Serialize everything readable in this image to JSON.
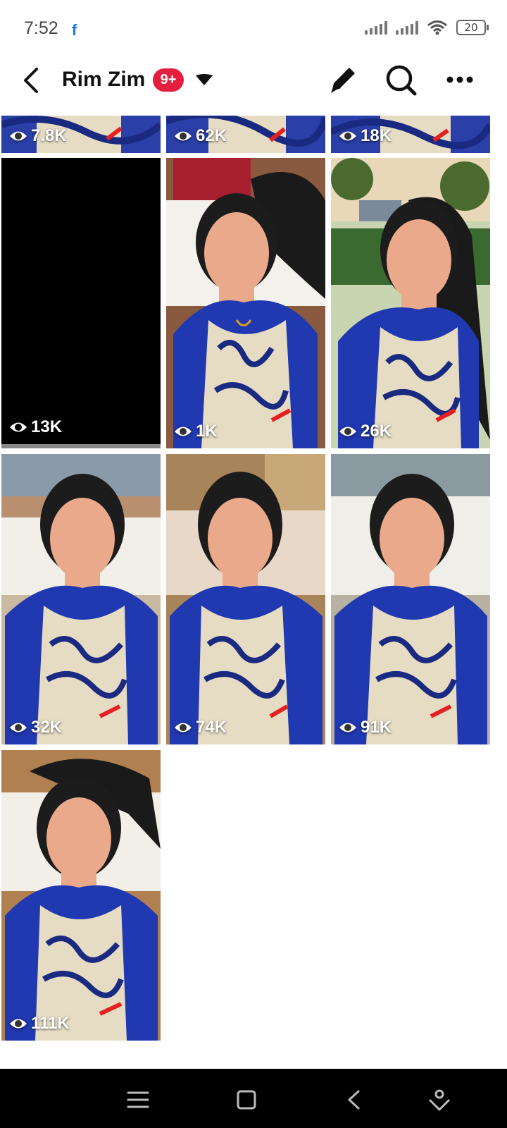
{
  "status_bar": {
    "time": "7:52",
    "notification_icon": "facebook-icon",
    "battery": "20"
  },
  "header": {
    "title": "Rim Zim",
    "badge": "9+",
    "icons": [
      "back-arrow-icon",
      "caret-down-icon",
      "pencil-icon",
      "search-icon",
      "more-dots-icon"
    ]
  },
  "grid": {
    "tiles": [
      {
        "views": "7.8K"
      },
      {
        "views": "62K"
      },
      {
        "views": "18K"
      },
      {
        "views": "13K"
      },
      {
        "views": "1K"
      },
      {
        "views": "26K"
      },
      {
        "views": "32K"
      },
      {
        "views": "74K"
      },
      {
        "views": "91K"
      },
      {
        "views": "111K"
      }
    ]
  },
  "nav_bar": {
    "icons": [
      "menu-icon",
      "home-square-icon",
      "back-chevron-icon",
      "assistant-icon"
    ]
  },
  "colors": {
    "accent": "#1877f2",
    "badge": "#e41e3f",
    "dress_blue": "#2038b0"
  }
}
